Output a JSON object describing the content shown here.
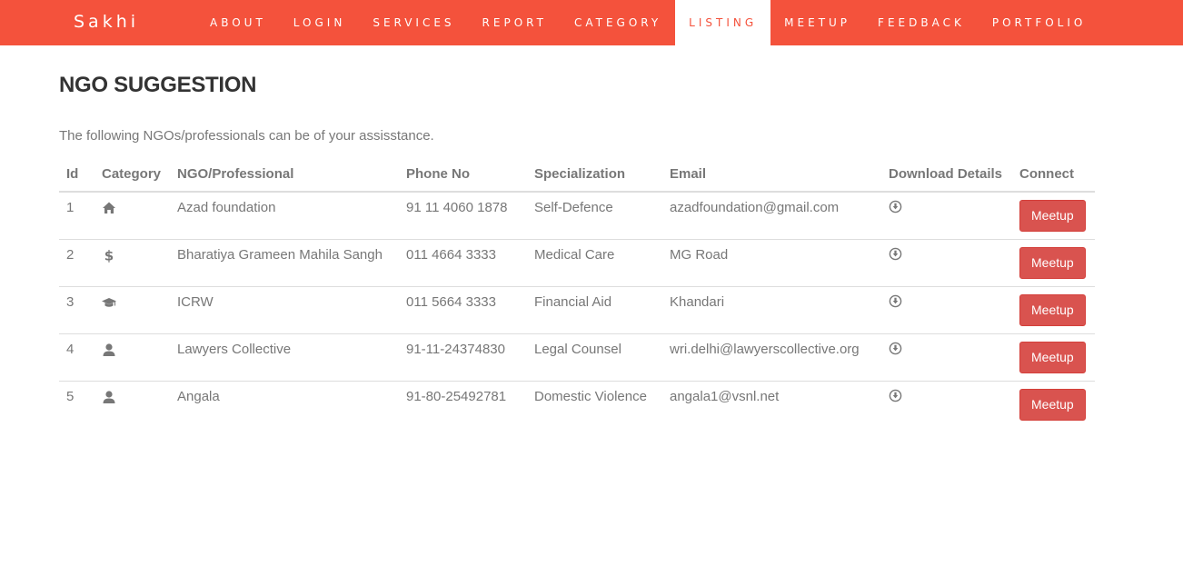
{
  "navbar": {
    "brand": "Sakhi",
    "items": [
      {
        "label": "ABOUT"
      },
      {
        "label": "LOGIN"
      },
      {
        "label": "SERVICES"
      },
      {
        "label": "REPORT"
      },
      {
        "label": "CATEGORY"
      },
      {
        "label": "LISTING",
        "active": true
      },
      {
        "label": "MEETUP"
      },
      {
        "label": "FEEDBACK"
      },
      {
        "label": "PORTFOLIO"
      }
    ],
    "accent_color": "#f4523c"
  },
  "page": {
    "title": "NGO SUGGESTION",
    "lead": "The following NGOs/professionals can be of your assisstance."
  },
  "table": {
    "headers": [
      "Id",
      "Category",
      "NGO/Professional",
      "Phone No",
      "Specialization",
      "Email",
      "Download Details",
      "Connect"
    ],
    "rows": [
      {
        "id": "1",
        "category_icon": "home-icon",
        "name": "Azad foundation",
        "phone": "91 11 4060 1878",
        "specialization": "Self-Defence",
        "email": "azadfoundation@gmail.com",
        "download_icon": "download-circle-icon",
        "button": "Meetup"
      },
      {
        "id": "2",
        "category_icon": "dollar-icon",
        "name": "Bharatiya Grameen Mahila Sangh",
        "phone": "011 4664 3333",
        "specialization": "Medical Care",
        "email": "MG Road",
        "download_icon": "download-circle-icon",
        "button": "Meetup"
      },
      {
        "id": "3",
        "category_icon": "graduation-cap-icon",
        "name": "ICRW",
        "phone": "011 5664 3333",
        "specialization": "Financial Aid",
        "email": "Khandari",
        "download_icon": "download-circle-icon",
        "button": "Meetup"
      },
      {
        "id": "4",
        "category_icon": "user-icon",
        "name": "Lawyers Collective",
        "phone": "91-11-24374830",
        "specialization": "Legal Counsel",
        "email": "wri.delhi@lawyerscollective.org",
        "download_icon": "download-circle-icon",
        "button": "Meetup"
      },
      {
        "id": "5",
        "category_icon": "user-icon",
        "name": "Angala",
        "phone": "91-80-25492781",
        "specialization": "Domestic Violence",
        "email": "angala1@vsnl.net",
        "download_icon": "download-circle-icon",
        "button": "Meetup"
      }
    ],
    "button_color": "#d9534f"
  }
}
